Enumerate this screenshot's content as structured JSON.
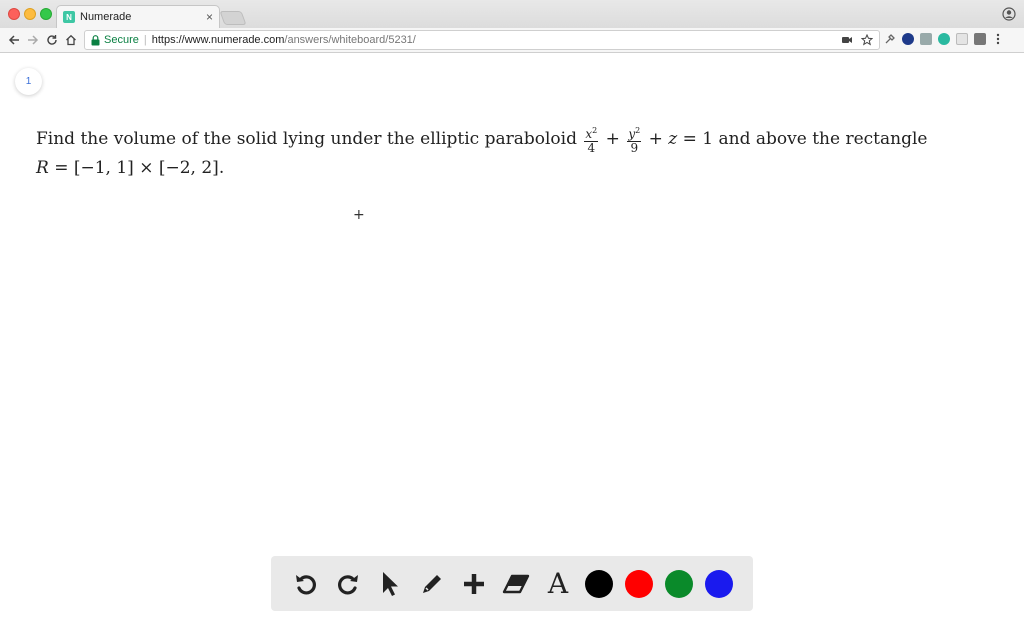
{
  "browser": {
    "tab_title": "Numerade",
    "tab_favicon_letter": "N",
    "secure_label": "Secure",
    "url_scheme_host": "https://www.numerade.com",
    "url_path": "/answers/whiteboard/5231/"
  },
  "page": {
    "page_number": "1",
    "problem_lead": "Find the volume of the solid lying under the elliptic paraboloid",
    "frac1_num": "x",
    "frac1_den": "4",
    "frac2_num": "y",
    "frac2_den": "9",
    "exp": "2",
    "plus": "+",
    "z_term": "z",
    "equals_one": "= 1",
    "problem_tail": "and above the rectangle",
    "rect_var": "R",
    "rect_def": "= [−1, 1] × [−2, 2]."
  },
  "whiteboard_toolbar": {
    "tools": [
      "undo-icon",
      "redo-icon",
      "pointer-icon",
      "pen-icon",
      "add-icon",
      "eraser-icon",
      "text-icon"
    ],
    "text_tool_label": "A",
    "colors": [
      "#000000",
      "#ff0000",
      "#0a8a2a",
      "#1a1aee"
    ]
  }
}
